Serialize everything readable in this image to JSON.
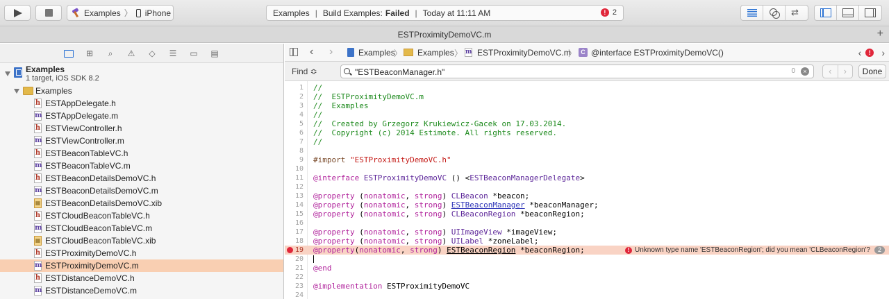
{
  "toolbar": {
    "scheme_name": "Examples",
    "scheme_sep": "〉",
    "device": "iPhone",
    "activity_project": "Examples",
    "activity_build_prefix": "Build Examples:",
    "activity_build_status": "Failed",
    "activity_time": "Today at 11:11 AM",
    "error_count": "2",
    "error_glyph": "!"
  },
  "tab": {
    "title": "ESTProximityDemoVC.m",
    "plus": "+"
  },
  "navigator": {
    "project_name": "Examples",
    "project_sub": "1 target, iOS SDK 8.2",
    "group_name": "Examples",
    "files": [
      {
        "name": "ESTAppDelegate.h",
        "type": "h"
      },
      {
        "name": "ESTAppDelegate.m",
        "type": "m"
      },
      {
        "name": "ESTViewController.h",
        "type": "h"
      },
      {
        "name": "ESTViewController.m",
        "type": "m"
      },
      {
        "name": "ESTBeaconTableVC.h",
        "type": "h"
      },
      {
        "name": "ESTBeaconTableVC.m",
        "type": "m"
      },
      {
        "name": "ESTBeaconDetailsDemoVC.h",
        "type": "h"
      },
      {
        "name": "ESTBeaconDetailsDemoVC.m",
        "type": "m"
      },
      {
        "name": "ESTBeaconDetailsDemoVC.xib",
        "type": "xib"
      },
      {
        "name": "ESTCloudBeaconTableVC.h",
        "type": "h"
      },
      {
        "name": "ESTCloudBeaconTableVC.m",
        "type": "m"
      },
      {
        "name": "ESTCloudBeaconTableVC.xib",
        "type": "xib"
      },
      {
        "name": "ESTProximityDemoVC.h",
        "type": "h"
      },
      {
        "name": "ESTProximityDemoVC.m",
        "type": "m",
        "selected": true
      },
      {
        "name": "ESTDistanceDemoVC.h",
        "type": "h"
      },
      {
        "name": "ESTDistanceDemoVC.m",
        "type": "m"
      }
    ]
  },
  "jumpbar": {
    "project": "Examples",
    "group": "Examples",
    "file": "ESTProximityDemoVC.m",
    "symbol": "@interface ESTProximityDemoVC()",
    "chev": "〉",
    "m_glyph": "m",
    "c_glyph": "C"
  },
  "find": {
    "label": "Find ≎",
    "query": "\"ESTBeaconManager.h\"",
    "count": "0",
    "done": "Done"
  },
  "code": {
    "lines": [
      {
        "n": "1",
        "html": "<span class=\"c-com\">//</span>"
      },
      {
        "n": "2",
        "html": "<span class=\"c-com\">//  ESTProximityDemoVC.m</span>"
      },
      {
        "n": "3",
        "html": "<span class=\"c-com\">//  Examples</span>"
      },
      {
        "n": "4",
        "html": "<span class=\"c-com\">//</span>"
      },
      {
        "n": "5",
        "html": "<span class=\"c-com\">//  Created by Grzegorz Krukiewicz-Gacek on 17.03.2014.</span>"
      },
      {
        "n": "6",
        "html": "<span class=\"c-com\">//  Copyright (c) 2014 Estimote. All rights reserved.</span>"
      },
      {
        "n": "7",
        "html": "<span class=\"c-com\">//</span>"
      },
      {
        "n": "8",
        "html": ""
      },
      {
        "n": "9",
        "html": "<span class=\"c-pre\">#import </span><span class=\"c-str\">\"ESTProximityDemoVC.h\"</span>"
      },
      {
        "n": "10",
        "html": ""
      },
      {
        "n": "11",
        "html": "<span class=\"c-kw\">@interface</span> <span class=\"c-cls\">ESTProximityDemoVC</span> () &lt;<span class=\"c-cls\">ESTBeaconManagerDelegate</span>&gt;"
      },
      {
        "n": "12",
        "html": ""
      },
      {
        "n": "13",
        "html": "<span class=\"c-kw\">@property</span> (<span class=\"c-kw\">nonatomic</span>, <span class=\"c-kw\">strong</span>) <span class=\"c-cls\">CLBeacon</span> *beacon;"
      },
      {
        "n": "14",
        "html": "<span class=\"c-kw\">@property</span> (<span class=\"c-kw\">nonatomic</span>, <span class=\"c-kw\">strong</span>) <span class=\"c-link\">ESTBeaconManager</span> *beaconManager;"
      },
      {
        "n": "15",
        "html": "<span class=\"c-kw\">@property</span> (<span class=\"c-kw\">nonatomic</span>, <span class=\"c-kw\">strong</span>) <span class=\"c-cls\">CLBeaconRegion</span> *beaconRegion;"
      },
      {
        "n": "16",
        "html": ""
      },
      {
        "n": "17",
        "html": "<span class=\"c-kw\">@property</span> (<span class=\"c-kw\">nonatomic</span>, <span class=\"c-kw\">strong</span>) <span class=\"c-cls\">UIImageView</span> *imageView;"
      },
      {
        "n": "18",
        "html": "<span class=\"c-kw\">@property</span> (<span class=\"c-kw\">nonatomic</span>, <span class=\"c-kw\">strong</span>) <span class=\"c-cls\">UILabel</span> *zoneLabel;"
      },
      {
        "n": "19",
        "html": "<span class=\"c-kw\">@property</span>(<span class=\"c-kw\">nonatomic</span>, <span class=\"c-kw\">strong</span>) <u>ESTBeaconRegion</u> *beaconRegion;",
        "error": true
      },
      {
        "n": "20",
        "html": "",
        "caret": true
      },
      {
        "n": "21",
        "html": "<span class=\"c-kw\">@end</span>"
      },
      {
        "n": "22",
        "html": ""
      },
      {
        "n": "23",
        "html": "<span class=\"c-kw\">@implementation</span> ESTProximityDemoVC"
      },
      {
        "n": "24",
        "html": ""
      }
    ],
    "error_message": "Unknown type name 'ESTBeaconRegion'; did you mean 'CLBeaconRegion'?",
    "error_count": "2"
  },
  "colors": {
    "error": "#e0263a",
    "selection": "#f9cfb2",
    "error_line": "#f9d3c4",
    "accent": "#2a72d4"
  }
}
